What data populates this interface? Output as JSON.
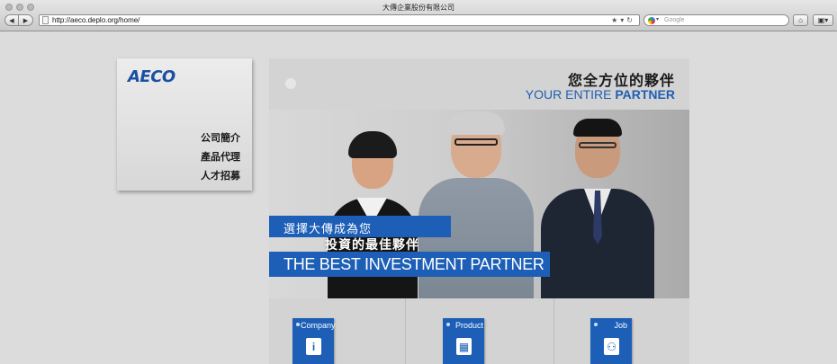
{
  "browser": {
    "window_title": "大傳企業股份有限公司",
    "url": "http://aeco.deplo.org/home/",
    "search_placeholder": "Google"
  },
  "sidebar": {
    "logo": "AECO",
    "items": [
      {
        "label": "公司簡介"
      },
      {
        "label": "產品代理"
      },
      {
        "label": "人才招募"
      }
    ]
  },
  "header": {
    "title_zh": "您全方位的夥伴",
    "title_en_prefix": "YOUR ENTIRE ",
    "title_en_bold": "PARTNER"
  },
  "hero": {
    "line1": "選擇大傳成為您",
    "line2": "投資的最佳夥伴",
    "line3": "THE BEST INVESTMENT PARTNER"
  },
  "cards": [
    {
      "label": "Company",
      "icon": "info-icon"
    },
    {
      "label": "Product",
      "icon": "chip-icon"
    },
    {
      "label": "Job",
      "icon": "people-icon"
    }
  ],
  "colors": {
    "brand_blue": "#1d5fb7",
    "logo_blue": "#1b4fa2"
  }
}
